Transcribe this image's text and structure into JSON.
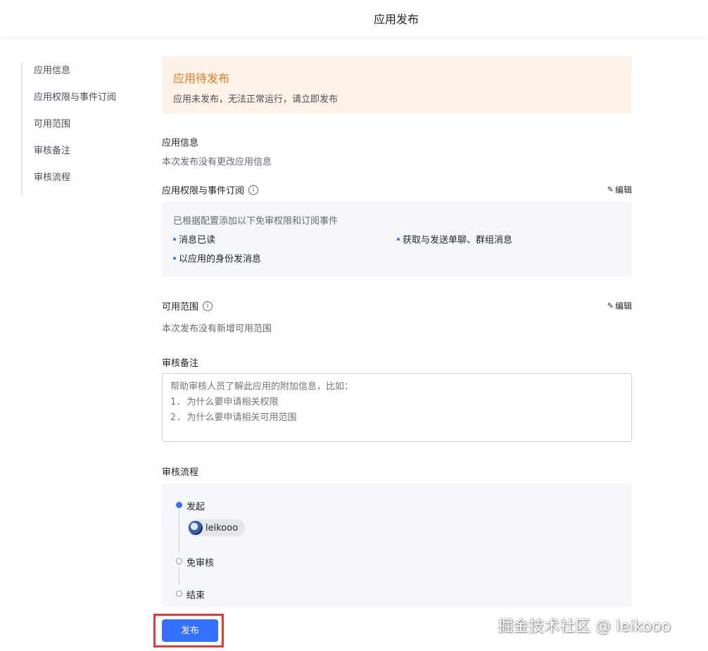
{
  "header": {
    "title": "应用发布"
  },
  "sidebar": {
    "items": [
      {
        "label": "应用信息"
      },
      {
        "label": "应用权限与事件订阅"
      },
      {
        "label": "可用范围"
      },
      {
        "label": "审核备注"
      },
      {
        "label": "审核流程"
      }
    ]
  },
  "banner": {
    "title": "应用待发布",
    "desc": "应用未发布，无法正常运行，请立即发布",
    "bg_color": "#fff2e8",
    "title_color": "#e07a1f"
  },
  "app_info": {
    "title": "应用信息",
    "desc": "本次发布没有更改应用信息"
  },
  "permissions": {
    "title": "应用权限与事件订阅",
    "edit_label": "编辑",
    "box_desc": "已根据配置添加以下免审权限和订阅事件",
    "items": [
      "消息已读",
      "获取与发送单聊、群组消息",
      "以应用的身份发消息"
    ]
  },
  "scope": {
    "title": "可用范围",
    "edit_label": "编辑",
    "desc": "本次发布没有新增可用范围"
  },
  "review_note": {
    "title": "审核备注",
    "placeholder": "帮助审核人员了解此应用的附加信息，比如：\n1. 为什么要申请相关权限\n2. 为什么要申请相关可用范围"
  },
  "review_flow": {
    "title": "审核流程",
    "steps": [
      {
        "label": "发起",
        "user": "leikooo"
      },
      {
        "label": "免审核"
      },
      {
        "label": "结束"
      }
    ]
  },
  "publish": {
    "label": "发布",
    "color": "#3370ff"
  },
  "watermark": {
    "text": "掘金技术社区 @ leikooo"
  }
}
